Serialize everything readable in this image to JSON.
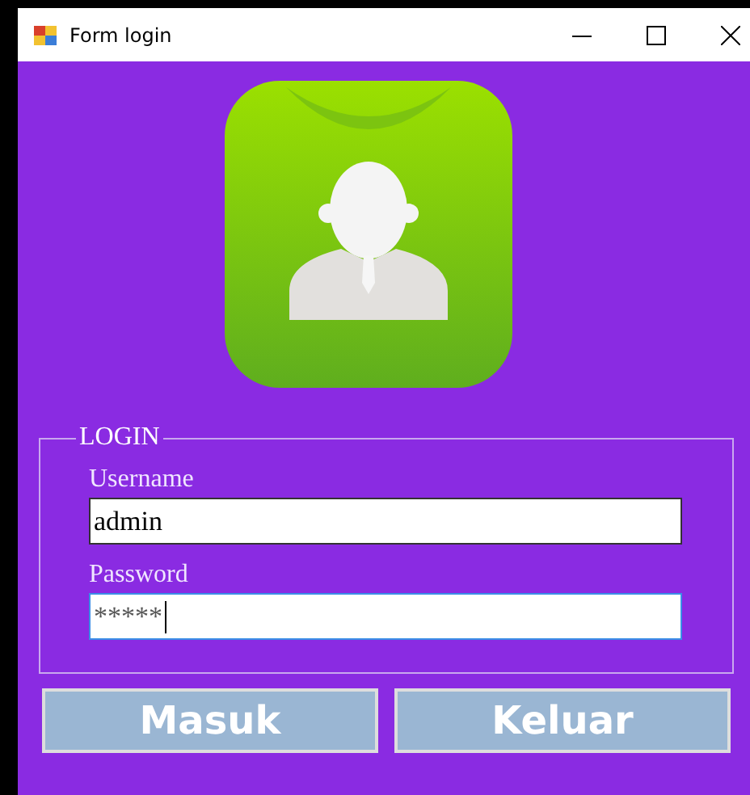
{
  "window": {
    "title": "Form login"
  },
  "group": {
    "legend": "LOGIN"
  },
  "fields": [
    {
      "label": "Username",
      "value": "admin",
      "focused": false
    },
    {
      "label": "Password",
      "value": "*****",
      "focused": true
    }
  ],
  "buttons": [
    "Masuk",
    "Keluar"
  ]
}
